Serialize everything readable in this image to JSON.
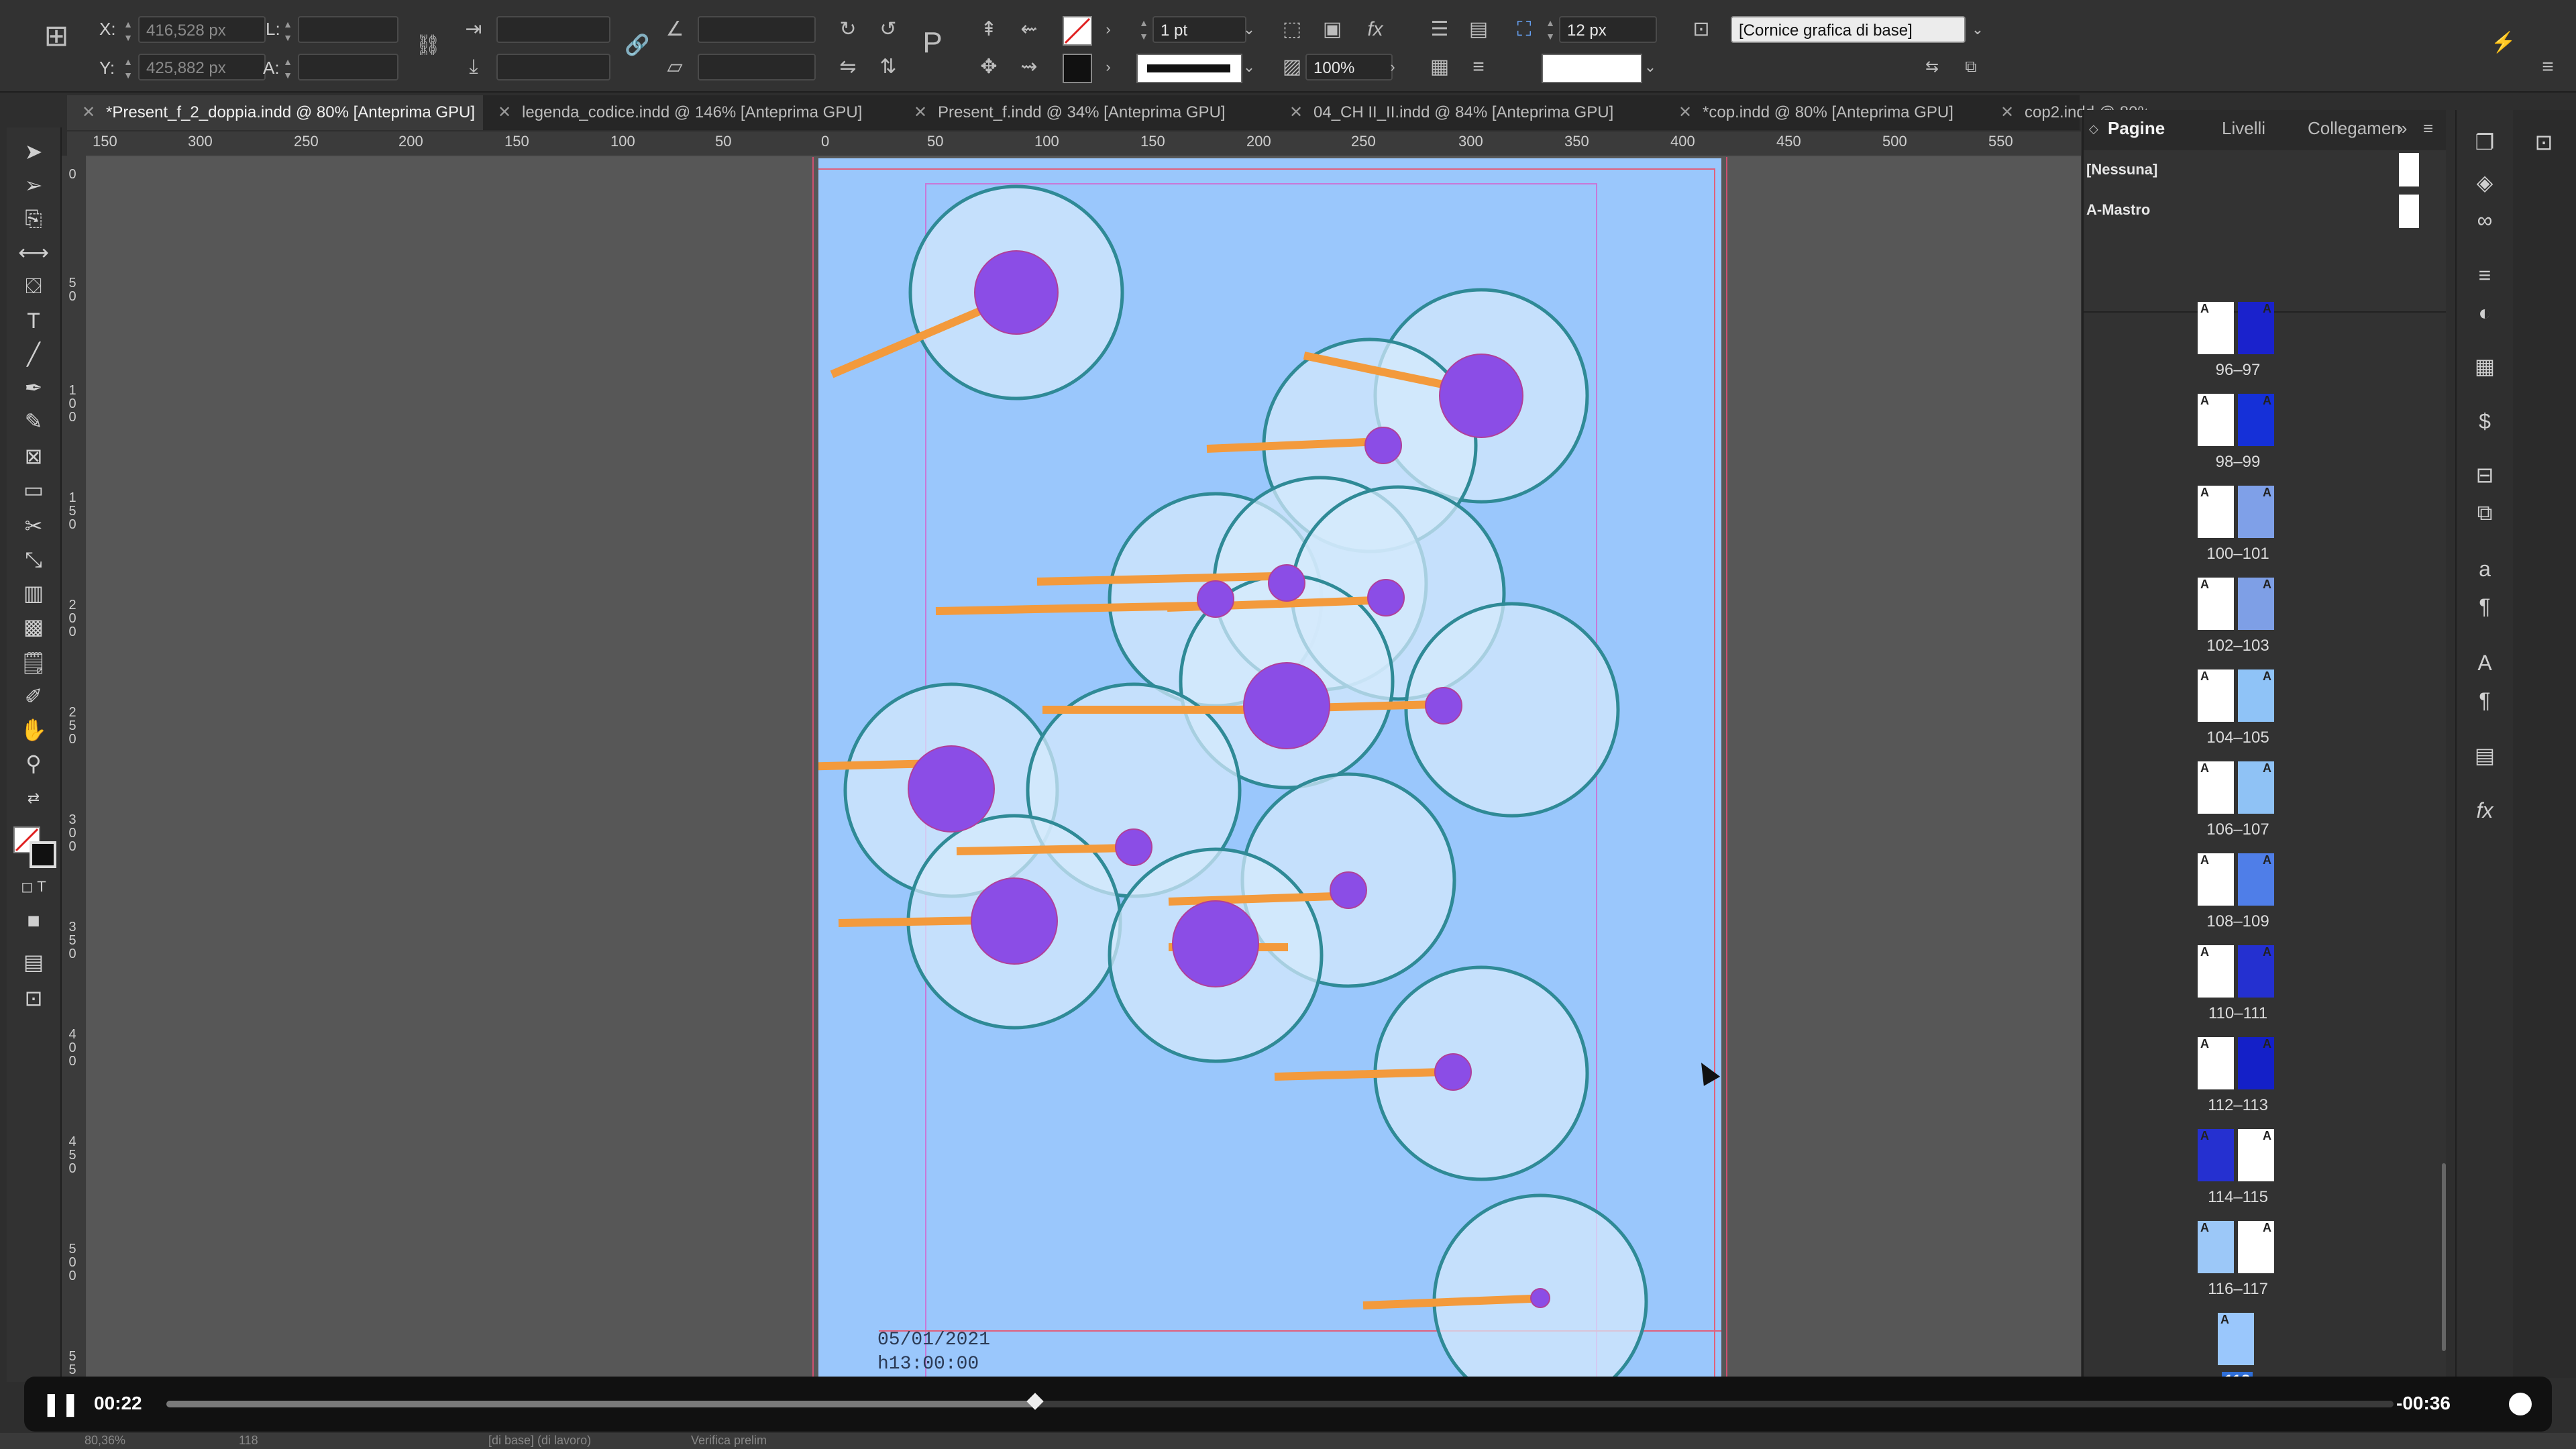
{
  "control_bar": {
    "x_label": "X:",
    "x_value": "416,528 px",
    "y_label": "Y:",
    "y_value": "425,882 px",
    "l_label": "L:",
    "a_label": "A:",
    "stroke_weight": "1 pt",
    "scale": "100%",
    "gap": "12 px",
    "object_style": "[Cornice grafica di base]"
  },
  "tabs": [
    {
      "label": "*Present_f_2_doppia.indd @ 80% [Anteprima GPU]",
      "active": true
    },
    {
      "label": "legenda_codice.indd @ 146% [Anteprima GPU]"
    },
    {
      "label": "Present_f.indd @ 34% [Anteprima GPU]"
    },
    {
      "label": "04_CH II_II.indd @ 84% [Anteprima GPU]"
    },
    {
      "label": "*cop.indd @ 80% [Anteprima GPU]"
    },
    {
      "label": "cop2.indd @ 80%"
    }
  ],
  "ruler_top": [
    "150",
    "300",
    "250",
    "200",
    "150",
    "100",
    "50",
    "0",
    "50",
    "100",
    "150",
    "200",
    "250",
    "300",
    "350",
    "400",
    "450",
    "500",
    "550"
  ],
  "ruler_left": [
    "0",
    "50",
    "100",
    "150",
    "200",
    "250",
    "300",
    "350",
    "400",
    "450",
    "500",
    "550"
  ],
  "document": {
    "date_text": "05/01/2021",
    "time_text": "h13:00:00",
    "colors": {
      "page": "#9ac7fc",
      "circle_fill": "#d6eafc",
      "circle_stroke": "#2f8a96",
      "dot": "#8b4de6",
      "line": "#f39a3c"
    }
  },
  "panel": {
    "tabs": [
      "Pagine",
      "Livelli",
      "Collegamen"
    ],
    "masters": [
      "[Nessuna]",
      "A-Mastro"
    ],
    "spreads": [
      {
        "label": "96–97",
        "left": "#ffffff",
        "right": "#1a22cc"
      },
      {
        "label": "98–99",
        "left": "#ffffff",
        "right": "#1530d8"
      },
      {
        "label": "100–101",
        "left": "#ffffff",
        "right": "#7fa0e8"
      },
      {
        "label": "102–103",
        "left": "#ffffff",
        "right": "#7e9fe6"
      },
      {
        "label": "104–105",
        "left": "#ffffff",
        "right": "#8fc3f7"
      },
      {
        "label": "106–107",
        "left": "#ffffff",
        "right": "#8fc2f5"
      },
      {
        "label": "108–109",
        "left": "#ffffff",
        "right": "#4f7ee8"
      },
      {
        "label": "110–111",
        "left": "#ffffff",
        "right": "#2430d0"
      },
      {
        "label": "112–113",
        "left": "#ffffff",
        "right": "#1420c8"
      },
      {
        "label": "114–115",
        "left": "#2530d0",
        "right": "#ffffff"
      },
      {
        "label": "116–117",
        "left": "#9cc8f8",
        "right": "#ffffff"
      },
      {
        "label": "118",
        "left": "#9ac7fc",
        "right": null,
        "selected": true
      }
    ]
  },
  "video": {
    "elapsed": "00:22",
    "remaining": "-00:36",
    "progress": 0.39
  },
  "status": {
    "zoom": "80,36%",
    "page": "118",
    "master": "[di base] (di lavoro)",
    "preflight": "Verifica prelim"
  }
}
